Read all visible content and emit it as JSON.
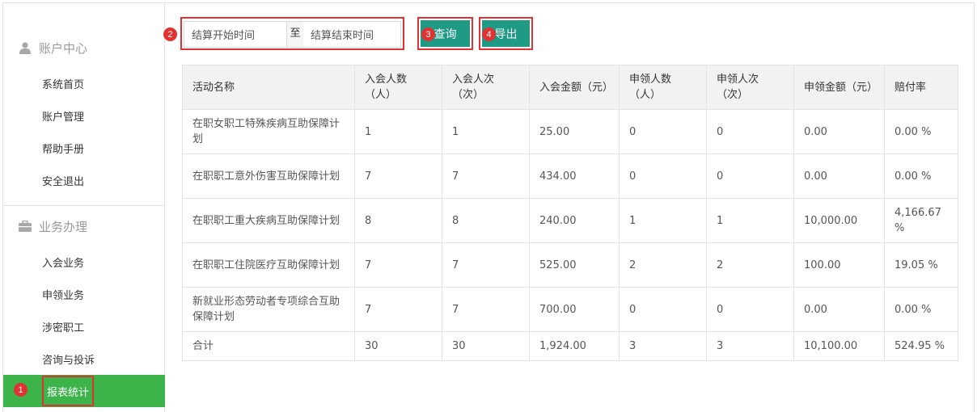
{
  "sidebar": {
    "sections": [
      {
        "title": "账户中心",
        "icon": "user-icon"
      },
      {
        "title": "业务办理",
        "icon": "briefcase-icon"
      }
    ],
    "account_items": [
      "系统首页",
      "账户管理",
      "帮助手册",
      "安全退出"
    ],
    "business_items": [
      "入会业务",
      "申领业务",
      "涉密职工",
      "咨询与投诉",
      "报表统计"
    ],
    "active_item": "报表统计"
  },
  "badges": [
    "1",
    "2",
    "3",
    "4"
  ],
  "toolbar": {
    "start_placeholder": "结算开始时间",
    "separator": "至",
    "end_placeholder": "结算结束时间",
    "query_label": "查询",
    "export_label": "导出"
  },
  "table": {
    "headers": [
      "活动名称",
      "入会人数（人）",
      "入会人次（次）",
      "入会金额（元）",
      "申领人数（人）",
      "申领人次（次）",
      "申领金额（元）",
      "赔付率"
    ],
    "rows": [
      [
        "在职女职工特殊疾病互助保障计划",
        "1",
        "1",
        "25.00",
        "0",
        "0",
        "0.00",
        "0.00 %"
      ],
      [
        "在职职工意外伤害互助保障计划",
        "7",
        "7",
        "434.00",
        "0",
        "0",
        "0.00",
        "0.00 %"
      ],
      [
        "在职职工重大疾病互助保障计划",
        "8",
        "8",
        "240.00",
        "1",
        "1",
        "10,000.00",
        "4,166.67 %"
      ],
      [
        "在职职工住院医疗互助保障计划",
        "7",
        "7",
        "525.00",
        "2",
        "2",
        "100.00",
        "19.05 %"
      ],
      [
        "新就业形态劳动者专项综合互助保障计划",
        "7",
        "7",
        "700.00",
        "0",
        "0",
        "0.00",
        "0.00 %"
      ],
      [
        "合计",
        "30",
        "30",
        "1,924.00",
        "3",
        "3",
        "10,100.00",
        "524.95 %"
      ]
    ]
  },
  "colors": {
    "accent_green": "#3cb44a",
    "button_teal": "#1e9a85",
    "highlight_red": "#e03232"
  }
}
